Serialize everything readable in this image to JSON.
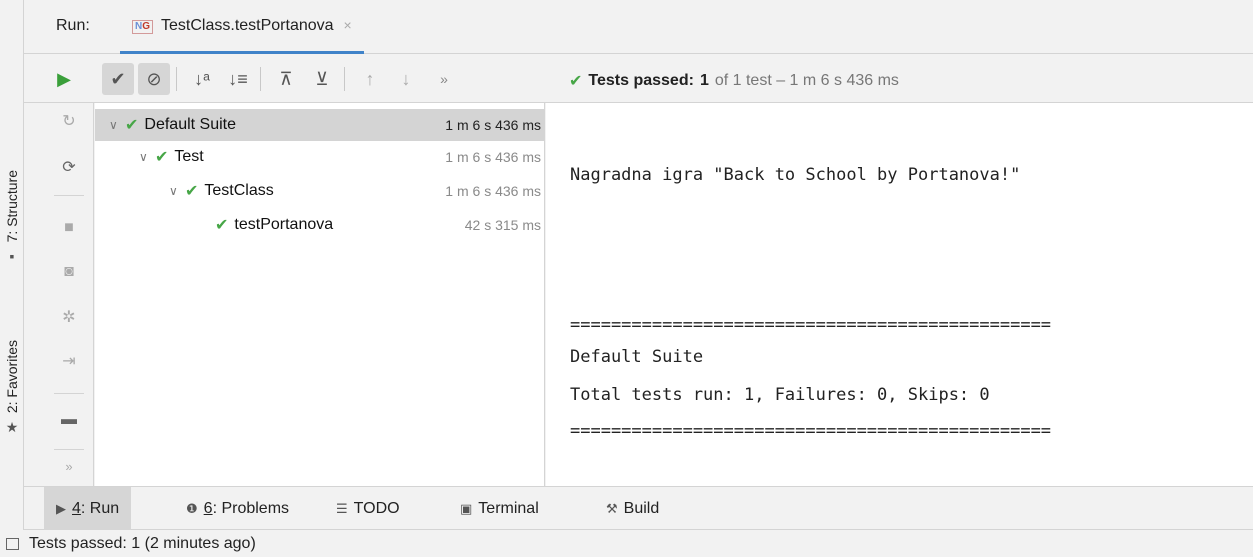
{
  "left_strip": {
    "structure_label": "7: Structure",
    "favorites_label": "2: Favorites"
  },
  "run_header": {
    "run_label": "Run:",
    "tab_badge_n": "N",
    "tab_badge_g": "G",
    "tab_title": "TestClass.testPortanova",
    "tab_close": "×"
  },
  "toolbar": {
    "overflow": "»",
    "status_prefix": "Tests passed:",
    "status_count": "1",
    "status_rest": "of 1 test – 1 m 6 s 436 ms"
  },
  "tree": {
    "rows": [
      {
        "name": "Default Suite",
        "duration": "1 m 6 s 436 ms"
      },
      {
        "name": "Test",
        "duration": "1 m 6 s 436 ms"
      },
      {
        "name": "TestClass",
        "duration": "1 m 6 s 436 ms"
      },
      {
        "name": "testPortanova",
        "duration": "42 s 315 ms"
      }
    ]
  },
  "console": {
    "lines": [
      "Nagradna igra \"Back to School by Portanova!\"",
      "===============================================",
      "Default Suite",
      "Total tests run: 1, Failures: 0, Skips: 0",
      "==============================================="
    ]
  },
  "bottom_tabs": {
    "run_num": "4",
    "run_label": ": Run",
    "problems_num": "6",
    "problems_label": ": Problems",
    "todo": "TODO",
    "terminal": "Terminal",
    "build": "Build"
  },
  "status_bar": {
    "text": "Tests passed: 1 (2 minutes ago)"
  }
}
